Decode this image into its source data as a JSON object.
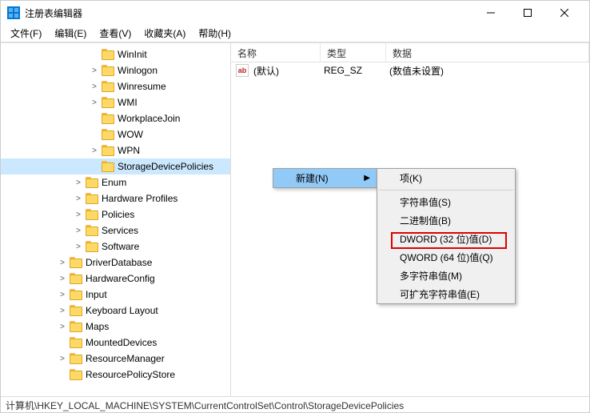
{
  "window": {
    "title": "注册表编辑器"
  },
  "menu": {
    "file": "文件(F)",
    "edit": "编辑(E)",
    "view": "查看(V)",
    "favorites": "收藏夹(A)",
    "help": "帮助(H)"
  },
  "tree": {
    "level4": [
      {
        "label": "WinInit",
        "exp": ""
      },
      {
        "label": "Winlogon",
        "exp": ">"
      },
      {
        "label": "Winresume",
        "exp": ">"
      },
      {
        "label": "WMI",
        "exp": ">"
      },
      {
        "label": "WorkplaceJoin",
        "exp": ""
      },
      {
        "label": "WOW",
        "exp": ""
      },
      {
        "label": "WPN",
        "exp": ">"
      },
      {
        "label": "StorageDevicePolicies",
        "exp": "",
        "selected": true
      }
    ],
    "level3": [
      {
        "label": "Enum",
        "exp": ">"
      },
      {
        "label": "Hardware Profiles",
        "exp": ">"
      },
      {
        "label": "Policies",
        "exp": ">"
      },
      {
        "label": "Services",
        "exp": ">"
      },
      {
        "label": "Software",
        "exp": ">"
      }
    ],
    "level2": [
      {
        "label": "DriverDatabase",
        "exp": ">"
      },
      {
        "label": "HardwareConfig",
        "exp": ">"
      },
      {
        "label": "Input",
        "exp": ">"
      },
      {
        "label": "Keyboard Layout",
        "exp": ">"
      },
      {
        "label": "Maps",
        "exp": ">"
      },
      {
        "label": "MountedDevices",
        "exp": ""
      },
      {
        "label": "ResourceManager",
        "exp": ">"
      },
      {
        "label": "ResourcePolicyStore",
        "exp": ""
      }
    ]
  },
  "list": {
    "headers": {
      "name": "名称",
      "type": "类型",
      "data": "数据"
    },
    "rows": [
      {
        "name": "(默认)",
        "type": "REG_SZ",
        "data": "(数值未设置)"
      }
    ],
    "icon_text": "ab"
  },
  "context": {
    "new": "新建(N)",
    "sub": [
      "项(K)",
      "—",
      "字符串值(S)",
      "二进制值(B)",
      "DWORD (32 位)值(D)",
      "QWORD (64 位)值(Q)",
      "多字符串值(M)",
      "可扩充字符串值(E)"
    ]
  },
  "status": "计算机\\HKEY_LOCAL_MACHINE\\SYSTEM\\CurrentControlSet\\Control\\StorageDevicePolicies"
}
